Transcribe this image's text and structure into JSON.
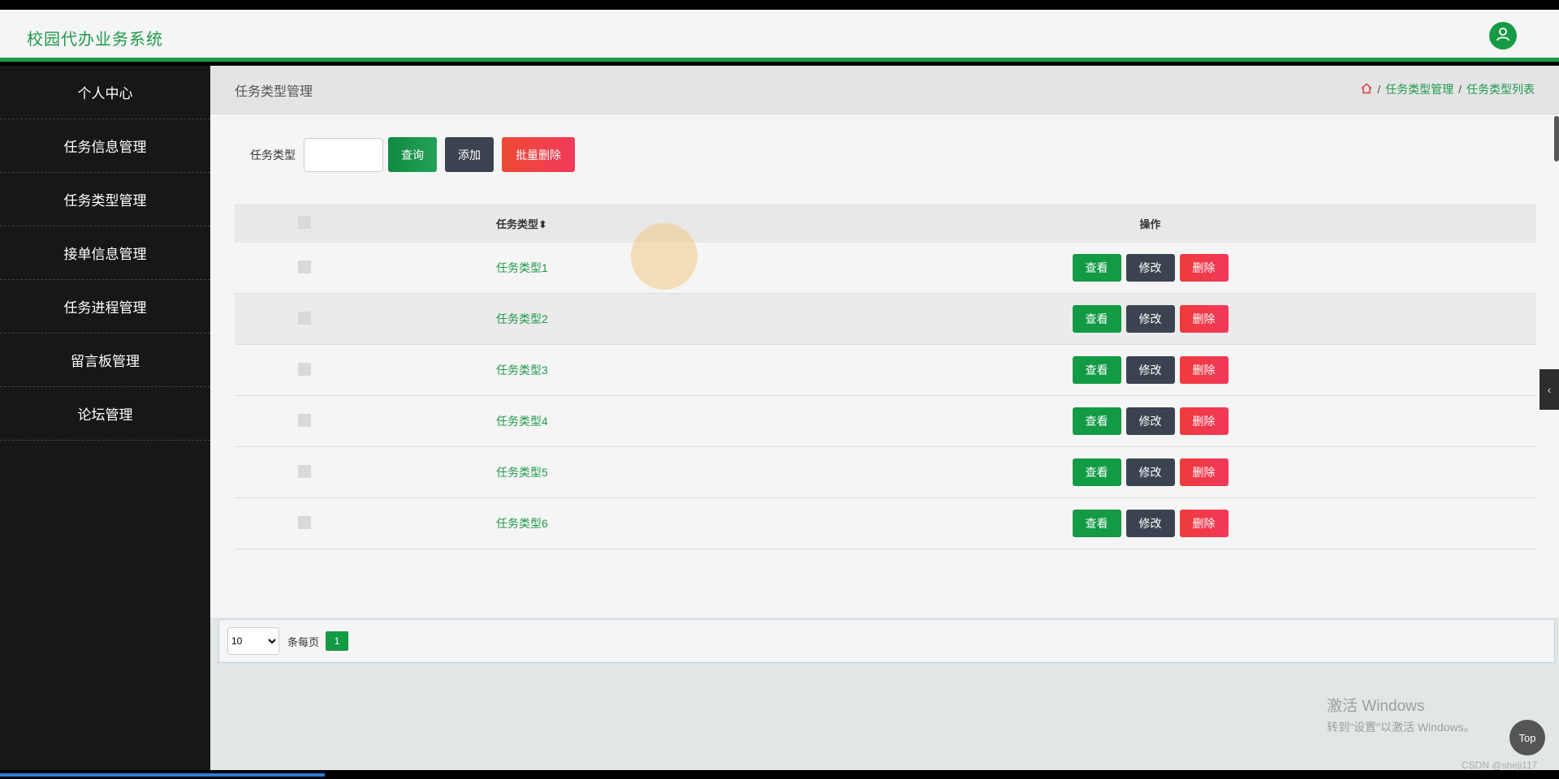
{
  "header": {
    "title": "校园代办业务系统"
  },
  "sidebar": {
    "items": [
      {
        "label": "个人中心"
      },
      {
        "label": "任务信息管理"
      },
      {
        "label": "任务类型管理"
      },
      {
        "label": "接单信息管理"
      },
      {
        "label": "任务进程管理"
      },
      {
        "label": "留言板管理"
      },
      {
        "label": "论坛管理"
      }
    ]
  },
  "page": {
    "title": "任务类型管理",
    "breadcrumb": [
      "任务类型管理",
      "任务类型列表"
    ],
    "breadcrumb_sep": "/"
  },
  "search": {
    "label": "任务类型",
    "value": "",
    "query_label": "查询",
    "add_label": "添加",
    "batch_delete_label": "批量删除"
  },
  "table": {
    "headers": {
      "type": "任务类型",
      "sort_glyph": "⬍",
      "ops": "操作"
    },
    "rows": [
      {
        "type": "任务类型1"
      },
      {
        "type": "任务类型2"
      },
      {
        "type": "任务类型3"
      },
      {
        "type": "任务类型4"
      },
      {
        "type": "任务类型5"
      },
      {
        "type": "任务类型6"
      }
    ],
    "ops": {
      "view": "查看",
      "edit": "修改",
      "delete": "删除"
    }
  },
  "pager": {
    "page_size": "10",
    "page_size_options": [
      "10"
    ],
    "per_page_label": "条每页",
    "current_page": "1"
  },
  "overlay": {
    "watermark_line1": "激活 Windows",
    "watermark_line2": "转到\"设置\"以激活 Windows。",
    "top_button": "Top",
    "credit": "CSDN @sheji117",
    "side_toggle": "‹"
  },
  "colors": {
    "accent": "#1e9a4b",
    "sidebar_bg": "#171717",
    "danger": "#f03b3b",
    "dark_button": "#3c4350"
  },
  "icons": {
    "avatar": "user-icon",
    "breadcrumb_home": "home-icon"
  }
}
